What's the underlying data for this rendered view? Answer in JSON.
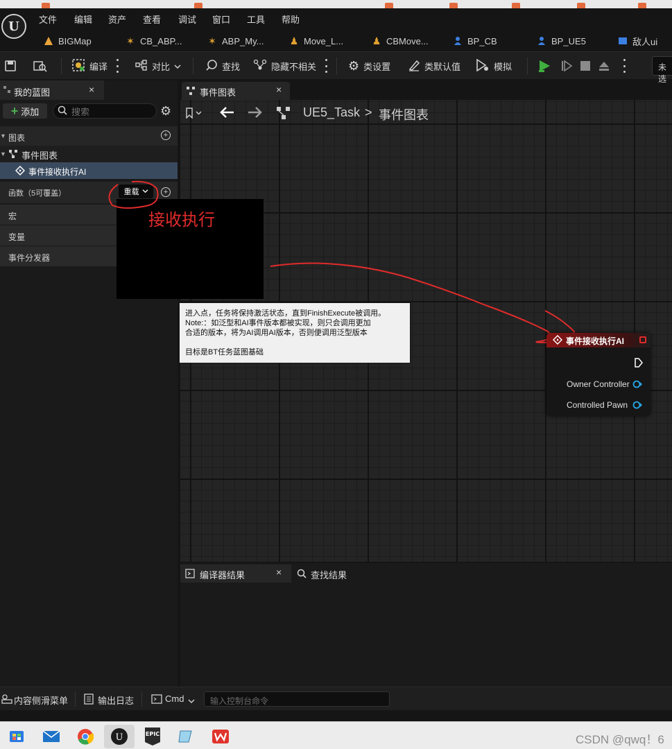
{
  "menu": [
    "文件",
    "编辑",
    "资产",
    "查看",
    "调试",
    "窗口",
    "工具",
    "帮助"
  ],
  "asset_tabs": [
    "BIGMap",
    "CB_ABP...",
    "ABP_My...",
    "Move_L...",
    "CBMove...",
    "BP_CB",
    "BP_UE5",
    "敌人ui"
  ],
  "toolbar": {
    "compile": "编译",
    "diff": "对比",
    "find": "查找",
    "hide_unrelated": "隐藏不相关",
    "class_settings": "类设置",
    "class_defaults": "类默认值",
    "simulate": "模拟",
    "debug_selector": "未选"
  },
  "left_panel": {
    "tab_title": "我的蓝图",
    "add_label": "添加",
    "search_placeholder": "搜索",
    "graphs_label": "图表",
    "event_graph_label": "事件图表",
    "event_item_label": "事件接收执行AI",
    "functions_label": "函数（5可覆盖）",
    "override_label": "重载",
    "macros_label": "宏",
    "variables_label": "变量",
    "dispatchers_label": "事件分发器"
  },
  "annotation": {
    "text": "接收执行"
  },
  "graph": {
    "tab_title": "事件图表",
    "breadcrumb_root": "UE5_Task",
    "breadcrumb_sep": ">",
    "breadcrumb_current": "事件图表"
  },
  "node": {
    "title": "事件接收执行AI",
    "pins": [
      "Owner Controller",
      "Controlled Pawn"
    ]
  },
  "tooltip": {
    "line1": "进入点，任务将保持激活状态，直到FinishExecute被调用。",
    "line2": "Note:：如泛型和AI事件版本都被实现，则只会调用更加",
    "line3": "合适的版本，将为AI调用AI版本，否则便调用泛型版本",
    "line4": "目标是BT任务蓝图基础"
  },
  "bottom_panel": {
    "compiler_tab": "编译器结果",
    "find_tab": "查找结果"
  },
  "statusbar": {
    "content_drawer": "内容侧滑菜单",
    "output_log": "输出日志",
    "cmd_label": "Cmd",
    "console_placeholder": "输入控制台命令"
  },
  "watermark": "CSDN @qwq！6",
  "colors": {
    "accent_red": "#e02b2b",
    "play_green": "#3fae3f",
    "pin_blue": "#27a6e6"
  }
}
